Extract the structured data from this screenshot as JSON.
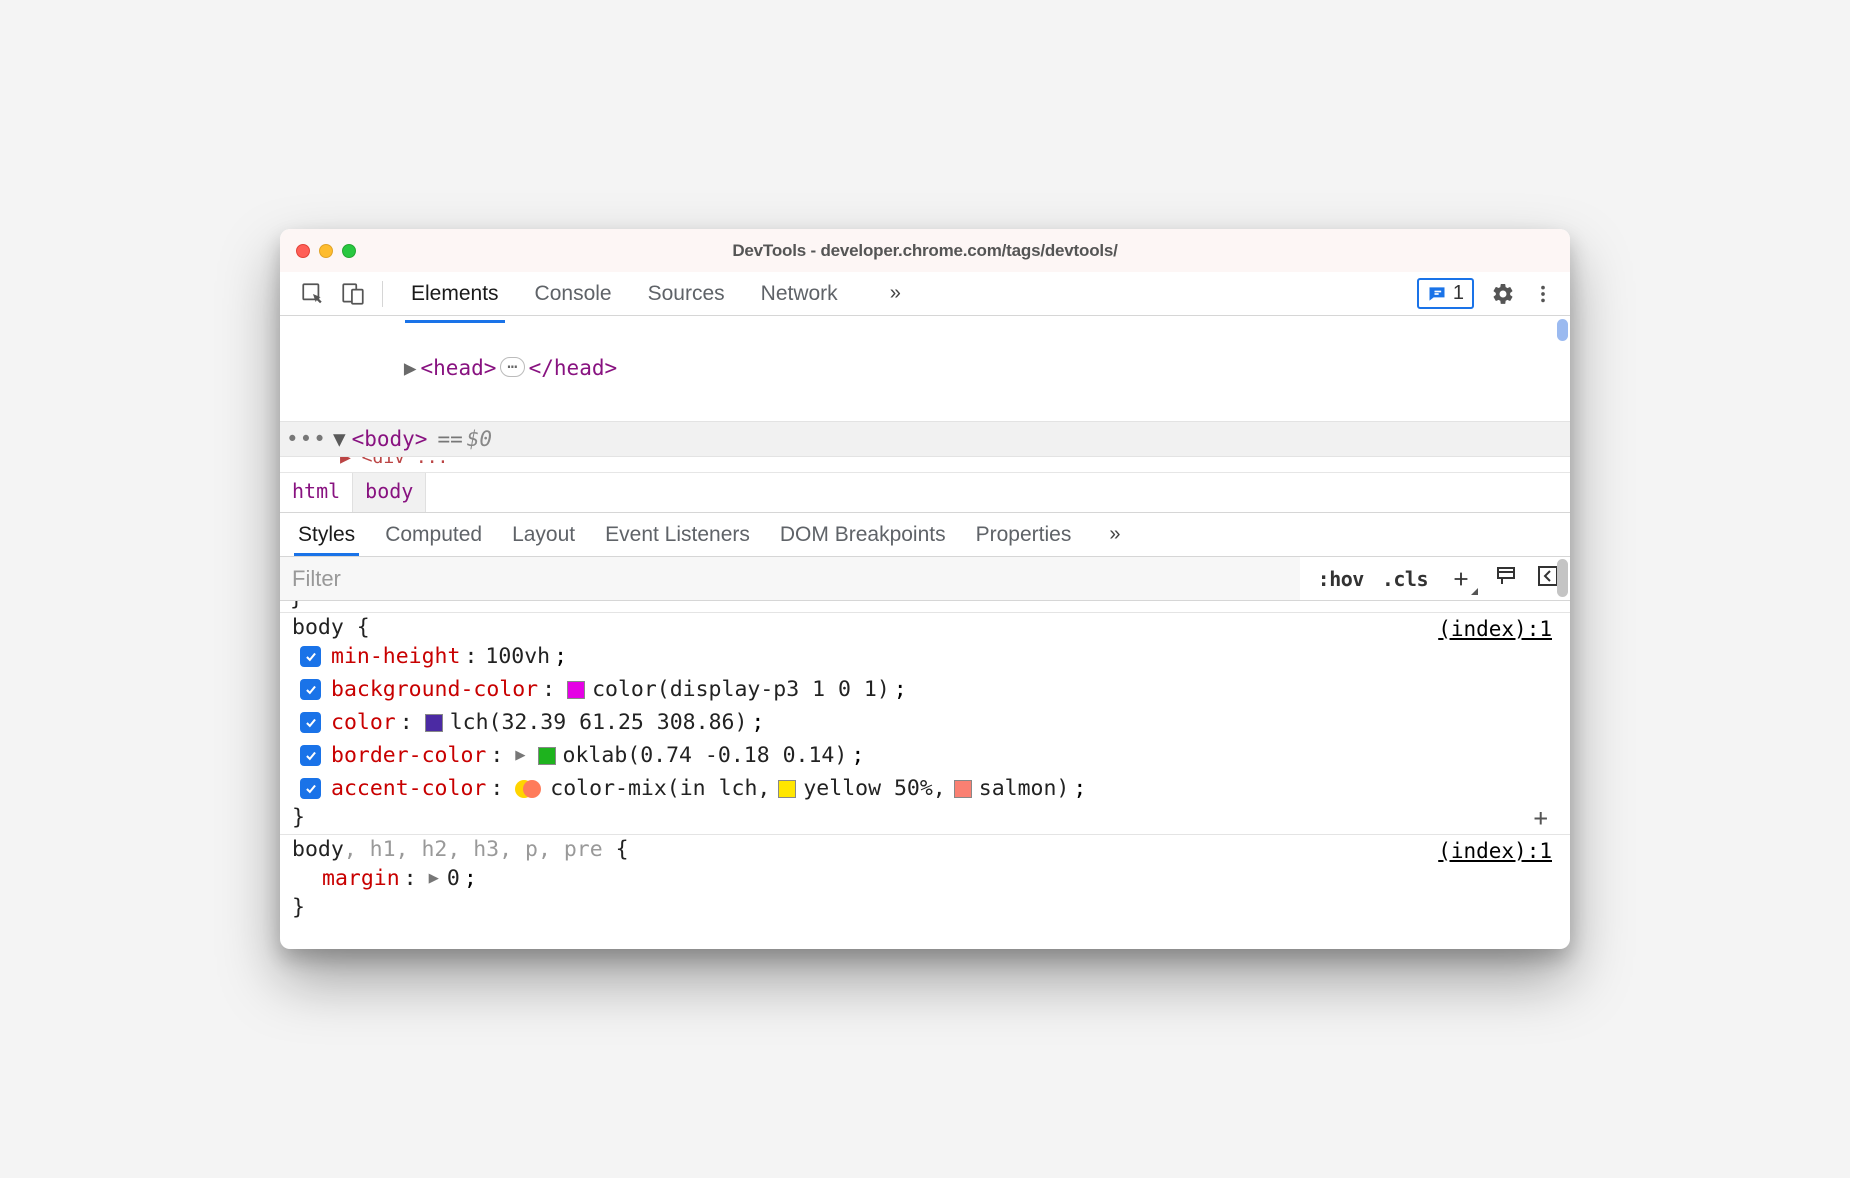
{
  "window": {
    "title": "DevTools - developer.chrome.com/tags/devtools/"
  },
  "toolbar": {
    "tabs": [
      "Elements",
      "Console",
      "Sources",
      "Network"
    ],
    "activeTab": "Elements",
    "overflow": "»",
    "issues_count": "1"
  },
  "dom": {
    "head_open": "<head>",
    "head_close": "</head>",
    "body_open": "<body>",
    "selected_marker_eq": "==",
    "selected_marker_var": "$0"
  },
  "breadcrumb": {
    "items": [
      "html",
      "body"
    ],
    "activeIndex": 1
  },
  "subtabs": {
    "items": [
      "Styles",
      "Computed",
      "Layout",
      "Event Listeners",
      "DOM Breakpoints",
      "Properties"
    ],
    "activeIndex": 0,
    "overflow": "»"
  },
  "filter": {
    "placeholder": "Filter",
    "hov": ":hov",
    "cls": ".cls"
  },
  "rule1": {
    "selector": "body",
    "source": "(index):1",
    "decls": [
      {
        "prop": "min-height",
        "value": "100vh",
        "swatch": null,
        "expand": false,
        "mix": false
      },
      {
        "prop": "background-color",
        "value": "color(display-p3 1 0 1)",
        "swatch": "#e500e5",
        "expand": false,
        "mix": false
      },
      {
        "prop": "color",
        "value": "lch(32.39 61.25 308.86)",
        "swatch": "#4b2aa3",
        "expand": false,
        "mix": false
      },
      {
        "prop": "border-color",
        "value": "oklab(0.74 -0.18 0.14)",
        "swatch": "#1eb31e",
        "expand": true,
        "mix": false
      },
      {
        "prop": "accent-color",
        "value": "color-mix(in lch, ",
        "swatch": null,
        "expand": false,
        "mix": true,
        "mix_parts": [
          {
            "swatch": "#ffe600",
            "text": "yellow 50%, "
          },
          {
            "swatch": "#fa8072",
            "text": "salmon)"
          }
        ]
      }
    ]
  },
  "rule2": {
    "selector_main": "body",
    "selector_rest": ", h1, h2, h3, p, pre",
    "source": "(index):1",
    "decl": {
      "prop": "margin",
      "value": "0",
      "expand": true
    }
  }
}
